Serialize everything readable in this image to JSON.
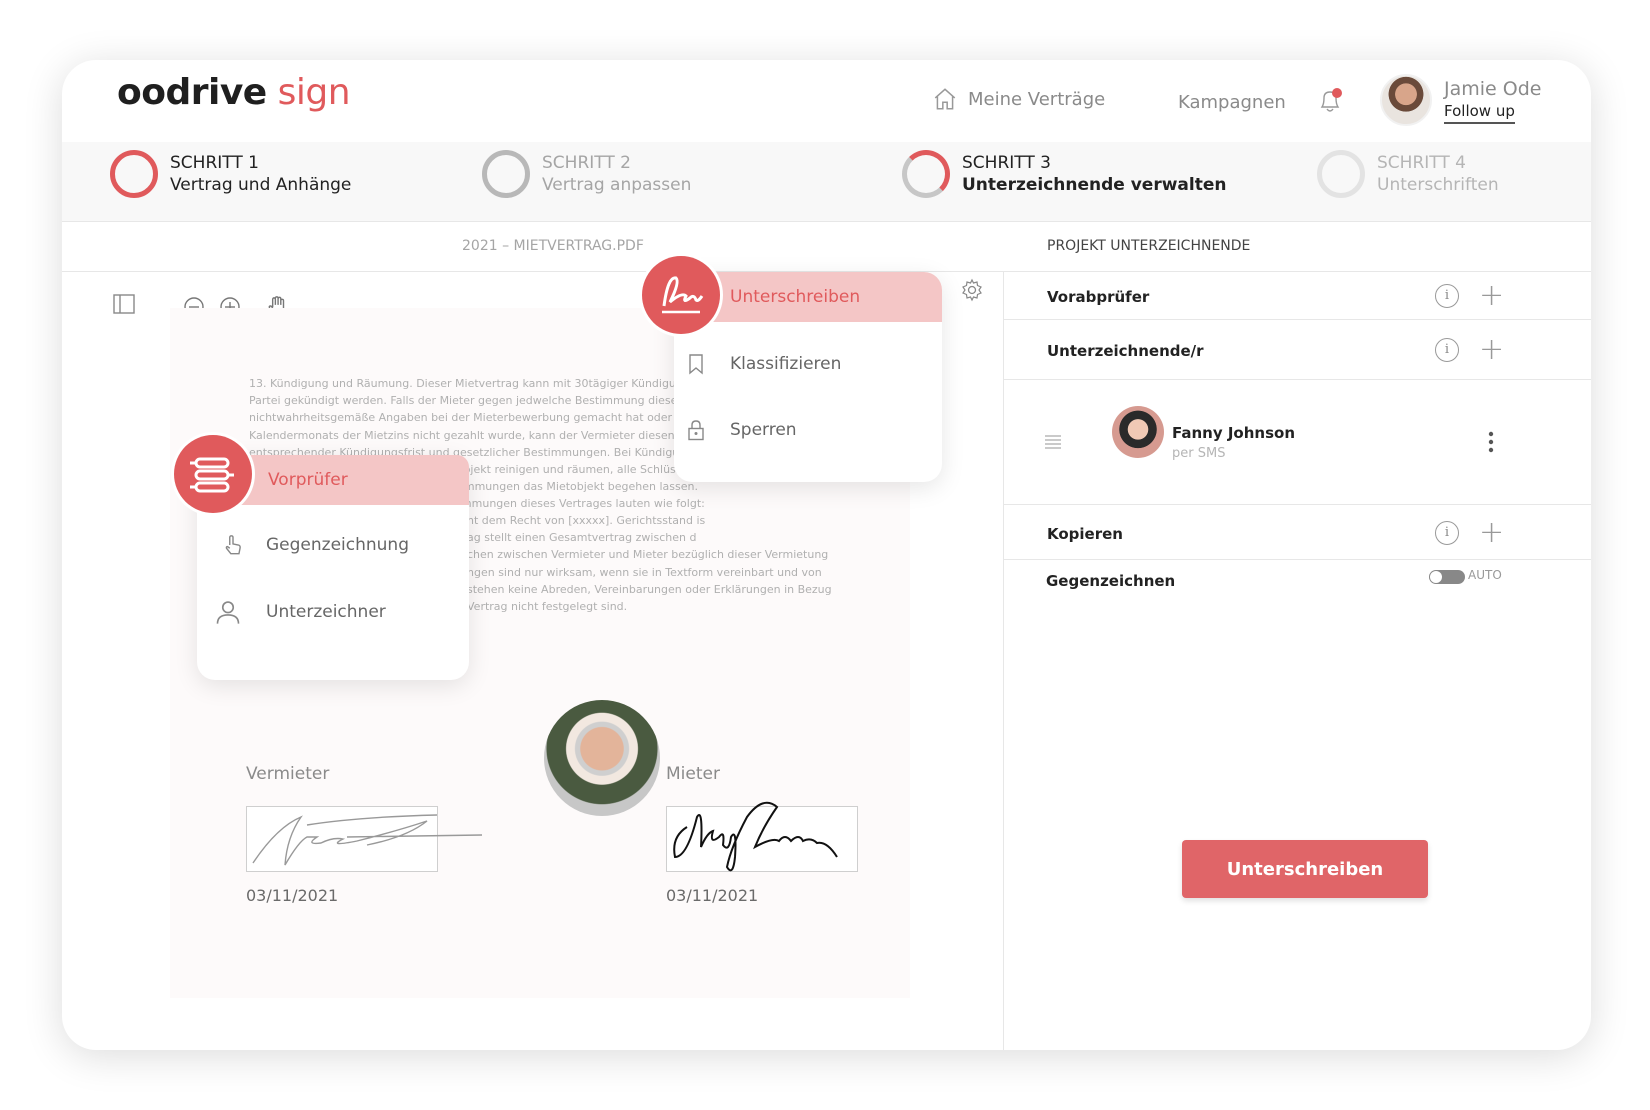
{
  "header": {
    "logo_dark": "oodrive",
    "logo_accent": " sign",
    "nav_home": "Meine Verträge",
    "nav_campaigns": "Kampagnen",
    "user_name": "Jamie Ode",
    "user_link": "Follow up"
  },
  "steps": [
    {
      "number": "SCHRITT 1",
      "title": "Vertrag und Anhänge",
      "state": "done"
    },
    {
      "number": "SCHRITT 2",
      "title": "Vertrag anpassen",
      "state": "inactive"
    },
    {
      "number": "SCHRITT 3",
      "title": "Unterzeichnende verwalten",
      "state": "active"
    },
    {
      "number": "SCHRITT 4",
      "title": "Unterschriften",
      "state": "inactive"
    }
  ],
  "document": {
    "filename": "2021 – MIETVERTRAG.PDF",
    "lines": [
      "13. Kündigung  und Räumung. Dieser Mietvertrag kann mit 30tägiger Kündigun",
      "Partei gekündigt werden. Falls der Mieter gegen jedwelche Bestimmung dieses Ver",
      "nichtwahrheitsgemäße Angaben bei der Mieterbewerbung gemacht hat oder bis z",
      "Kalendermonats der Mietzins nicht gezahlt wurde, kann der Vermieter diesen Vertra",
      "entsprechender Kündigungsfrist und gesetzlicher Bestimmungen.  Bei Kündigung ",
      "wird der Mieter unverzüglich das Mietobjekt reinigen und räumen, alle Schlüssel de",
      "und den Vermieter gemäß  diesen Bestimmungen das Mietobjekt begehen lassen.",
      "14. Zusatzbestimmungen.  Zusatzbestimmungen dieses Vertrages lauten wie folgt:"
    ],
    "lines_right": [
      "nt dem Recht von [xxxxx]. Gerichtsstand is",
      "ag stellt einen Gesamtvertrag zwischen d",
      "chen zwischen Vermieter und Mieter bezüglich dieser Vermietung",
      "ngen sind nur wirksam, wenn sie in Textform vereinbart und von",
      "stehen keine Abreden, Vereinbarungen oder Erklärungen in Bezug",
      "Vertrag nicht festgelegt sind."
    ],
    "landlord_label": "Vermieter",
    "tenant_label": "Mieter",
    "landlord_date": "03/11/2021",
    "tenant_date": "03/11/2021"
  },
  "role_menu": {
    "active": "Vorprüfer",
    "items": [
      "Gegenzeichnung",
      "Unterzeichner"
    ]
  },
  "action_menu": {
    "active": "Unterschreiben",
    "items": [
      "Klassifizieren",
      "Sperren"
    ]
  },
  "panel": {
    "title": "PROJEKT UNTERZEICHNENDE",
    "reviewers": "Vorabprüfer",
    "signers": "Unterzeichnende/r",
    "signer": {
      "name": "Fanny Johnson",
      "channel": "per SMS"
    },
    "copy": "Kopieren",
    "countersign": "Gegenzeichnen",
    "toggle_label": "AUTO",
    "cta": "Unterschreiben"
  },
  "colors": {
    "accent": "#e05a5c",
    "accent_light": "#f4c6c6"
  }
}
